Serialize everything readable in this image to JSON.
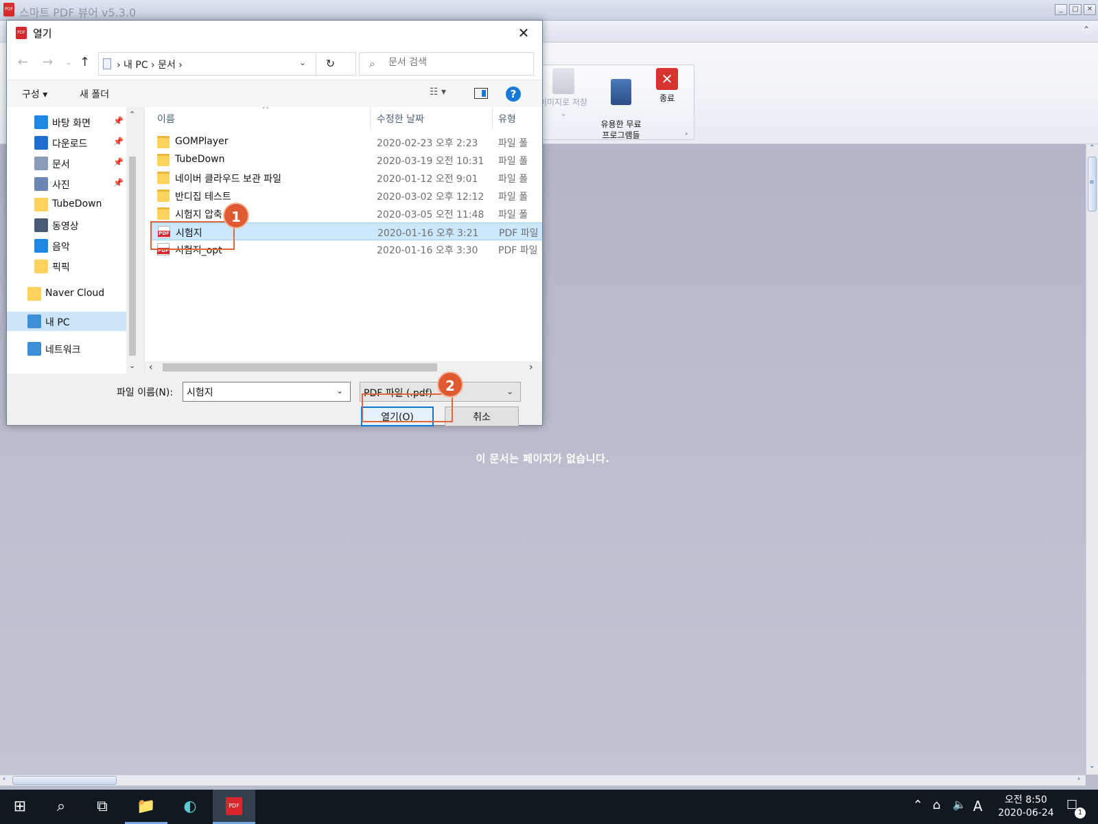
{
  "app": {
    "title": "스마트 PDF 뷰어 v5.3.0",
    "logo_text": "PDF",
    "window_controls": [
      "_",
      "□",
      "✕"
    ],
    "ribbon_collapse": "⌃",
    "ribbon_buttons": [
      {
        "label": "이미지로 저장",
        "sub": "⌄",
        "icon": "save-image-icon",
        "disabled": true
      },
      {
        "label": "유용한 무료\n프로그램들",
        "icon": "book-star-icon"
      },
      {
        "label": "종료",
        "icon": "exit-icon"
      }
    ],
    "group_launcher": "›",
    "empty_message": "이 문서는 페이지가 없습니다.",
    "scroll_grip": "≡"
  },
  "dialog": {
    "title": "열기",
    "icon_text": "PDF",
    "close": "✕",
    "nav": {
      "back": "←",
      "forward": "→",
      "recent": "⌄",
      "up": "↑"
    },
    "address": {
      "crumbs": "›  내 PC  ›  문서  ›",
      "dropdown": "⌄",
      "refresh": "↻"
    },
    "search": {
      "icon": "⌕",
      "placeholder": "문서 검색"
    },
    "toolbar": {
      "organize": "구성 ▾",
      "new_folder": "새 폴더",
      "view": "☷ ▾",
      "help": "?"
    },
    "nav_pane": [
      {
        "label": "바탕 화면",
        "icon": "desktop-icon",
        "pinned": true,
        "color": "#1e88e5"
      },
      {
        "label": "다운로드",
        "icon": "download-icon",
        "pinned": true,
        "color": "#1e6fd1"
      },
      {
        "label": "문서",
        "icon": "documents-icon",
        "pinned": true,
        "color": "#8a9bb8"
      },
      {
        "label": "사진",
        "icon": "pictures-icon",
        "pinned": true,
        "color": "#6b86b0"
      },
      {
        "label": "TubeDown",
        "icon": "folder-icon",
        "pinned": false,
        "color": "#ffd35c"
      },
      {
        "label": "동영상",
        "icon": "videos-icon",
        "pinned": false,
        "color": "#4a5b78"
      },
      {
        "label": "음악",
        "icon": "music-icon",
        "pinned": false,
        "color": "#1e88e5"
      },
      {
        "label": "픽픽",
        "icon": "folder-icon",
        "pinned": false,
        "color": "#ffd35c"
      },
      {
        "label": "Naver Cloud",
        "icon": "folder-icon",
        "pinned": false,
        "color": "#ffd35c"
      },
      {
        "label": "내 PC",
        "icon": "this-pc-icon",
        "pinned": false,
        "color": "#3d8fd8",
        "selected": true
      },
      {
        "label": "네트워크",
        "icon": "network-icon",
        "pinned": false,
        "color": "#3d8fd8"
      }
    ],
    "pin_glyph": "📌",
    "columns": {
      "name": "이름",
      "modified": "수정한 날짜",
      "type": "유형",
      "sort_indicator": "^"
    },
    "files": [
      {
        "name": "GOMPlayer",
        "modified": "2020-02-23 오후 2:23",
        "type": "파일 폴",
        "kind": "folder"
      },
      {
        "name": "TubeDown",
        "modified": "2020-03-19 오전 10:31",
        "type": "파일 폴",
        "kind": "folder"
      },
      {
        "name": "네이버 클라우드 보관 파일",
        "modified": "2020-01-12 오전 9:01",
        "type": "파일 폴",
        "kind": "folder"
      },
      {
        "name": "반디집 테스트",
        "modified": "2020-03-02 오후 12:12",
        "type": "파일 폴",
        "kind": "folder"
      },
      {
        "name": "시험지 압축",
        "modified": "2020-03-05 오전 11:48",
        "type": "파일 폴",
        "kind": "folder"
      },
      {
        "name": "시험지",
        "modified": "2020-01-16 오후 3:21",
        "type": "PDF 파일",
        "kind": "pdf",
        "selected": true
      },
      {
        "name": "시험지_opt",
        "modified": "2020-01-16 오후 3:30",
        "type": "PDF 파일",
        "kind": "pdf"
      }
    ],
    "scroll_left": "‹",
    "scroll_right": "›",
    "scroll_down": "⌄",
    "scroll_up": "⌃",
    "filename_label": "파일 이름(N):",
    "filename_value": "시험지",
    "filetype_value": "PDF 파일 (.pdf)",
    "open_label": "열기(O)",
    "cancel_label": "취소",
    "dropdown_glyph": "⌄"
  },
  "callouts": {
    "step1": "1",
    "step2": "2"
  },
  "taskbar": {
    "start": "⊞",
    "search": "⌕",
    "task_view": "⧉",
    "apps": [
      {
        "name": "file-explorer-icon",
        "glyph": "📁"
      },
      {
        "name": "browser-icon",
        "glyph": "◐"
      },
      {
        "name": "pdf-viewer-icon",
        "glyph": "PDF",
        "active": true
      }
    ],
    "tray": {
      "chevron": "⌃",
      "network": "⌂",
      "volume": "🔈",
      "ime": "A",
      "notifications": "☐",
      "notification_count": "1"
    },
    "clock_time": "오전 8:50",
    "clock_date": "2020-06-24"
  }
}
